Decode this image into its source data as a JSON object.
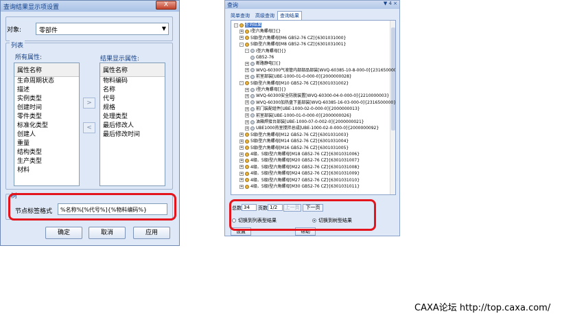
{
  "dialog": {
    "title": "查询结果显示项设置",
    "close_label": "X",
    "object_label": "对象:",
    "object_value": "零部件",
    "list_group_label": "列表",
    "all_attrs_caption": "所有属性:",
    "result_attrs_caption": "结果显示属性:",
    "all_attrs_header": "属性名称",
    "all_attrs": [
      "生命周期状态",
      "描述",
      "实例类型",
      "创建时间",
      "零件类型",
      "标准化类型",
      "创建人",
      "重量",
      "结构类型",
      "生产类型",
      "材料"
    ],
    "result_attrs_header": "属性名称",
    "result_attrs": [
      "物料编码",
      "名称",
      "代号",
      "规格",
      "处理类型",
      "最后修改人",
      "最后修改时间"
    ],
    "move_right": ">",
    "move_left": "<",
    "tree_group_label": "树",
    "format_label": "节点标签格式",
    "format_value": "%名称%[%代号%]{%物料编码%}",
    "ok_label": "确定",
    "cancel_label": "取消",
    "apply_label": "应用"
  },
  "panel": {
    "title": "查询",
    "ctrl": "▼ 4 ×",
    "tabs": [
      "简单查询",
      "高级查询",
      "查询结果"
    ],
    "tree": [
      {
        "d": 0,
        "t": "查询结果",
        "exp": "-",
        "sel": true
      },
      {
        "d": 1,
        "t": "I型六角螺母[]{}",
        "exp": "+"
      },
      {
        "d": 1,
        "t": "5级I型六角螺母[M6 GB52-76 CZ]{6301031000}",
        "exp": "+"
      },
      {
        "d": 1,
        "t": "5级I型六角螺母[M8 GB52-76 CZ]{6301031001}",
        "exp": "-"
      },
      {
        "d": 2,
        "t": "I型六角螺母[]{}",
        "exp": "-"
      },
      {
        "d": 3,
        "t": "GB52-76",
        "exp": ""
      },
      {
        "d": 2,
        "t": "断路静电[]{}",
        "exp": "+"
      },
      {
        "d": 2,
        "t": "WVQ-60300气液管内部部品部装[WVQ-60385-10-8-000-0]{2316500000}",
        "exp": "+"
      },
      {
        "d": 2,
        "t": "前室部装[UBE-1000-01-0-000-0]{2000000028}",
        "exp": "+"
      },
      {
        "d": 1,
        "t": "5级I型六角螺母[M10 GB52-76 CZ]{6301031002}",
        "exp": "-"
      },
      {
        "d": 2,
        "t": "I型六角螺母[]{}",
        "exp": "+"
      },
      {
        "d": 2,
        "t": "WVQ-60300安全防脱装置[WVQ-60300-04-0-000-0]{2210000003}",
        "exp": "+"
      },
      {
        "d": 2,
        "t": "WVQ-60300加热盘下盖部装[WVQ-60385-16-03-000-0]{2316500000}",
        "exp": "+"
      },
      {
        "d": 2,
        "t": "前门装配组件[UBE-1000-02-0-000-0]{2000000013}",
        "exp": "+"
      },
      {
        "d": 2,
        "t": "前室部装[UBE-1000-01-0-000-0]{2000000026}",
        "exp": "+"
      },
      {
        "d": 2,
        "t": "油箱焊接台部装[UBE-1000-07-0-002-0]{2000000021}",
        "exp": "+"
      },
      {
        "d": 2,
        "t": "UBE1000热室搅拌总成[UBE-1000-02-0-000-0]{2000000092}",
        "exp": "+"
      },
      {
        "d": 1,
        "t": "5级I型六角螺母[M12 GB52-76 CZ]{6301031003}",
        "exp": "+"
      },
      {
        "d": 1,
        "t": "5级I型六角螺母[M14 GB52-76 CZ]{6301031004}",
        "exp": "+"
      },
      {
        "d": 1,
        "t": "5级I型六角螺母[M16 GB52-76 CZ]{6301031005}",
        "exp": "+"
      },
      {
        "d": 1,
        "t": "4级、5级I型六角螺母[M18 GB52-76 CZ]{6301031006}",
        "exp": "+"
      },
      {
        "d": 1,
        "t": "4级、5级I型六角螺母[M20 GB52-76 CZ]{6301031007}",
        "exp": "+"
      },
      {
        "d": 1,
        "t": "4级、5级I型六角螺母[M22 GB52-76 CZ]{6301031008}",
        "exp": "+"
      },
      {
        "d": 1,
        "t": "4级、5级I型六角螺母[M24 GB52-76 CZ]{6301031009}",
        "exp": "+"
      },
      {
        "d": 1,
        "t": "4级、5级I型六角螺母[M27 GB52-76 CZ]{6301031010}",
        "exp": "+"
      },
      {
        "d": 1,
        "t": "4级、5级I型六角螺母[M30 GB52-76 CZ]{6301031011}",
        "exp": "+"
      }
    ],
    "total_label": "总数",
    "total_value": "34",
    "page_label": "页数",
    "page_value": "1/2",
    "prev_label": "上一页",
    "next_label": "下一页",
    "radio_list_label": "切换到列表型结果",
    "radio_tree_label": "切换到树型结果",
    "btn_left_label": "设置",
    "btn_right_label": "帮助"
  },
  "footer": "CAXA论坛 http://top.caxa.com/"
}
